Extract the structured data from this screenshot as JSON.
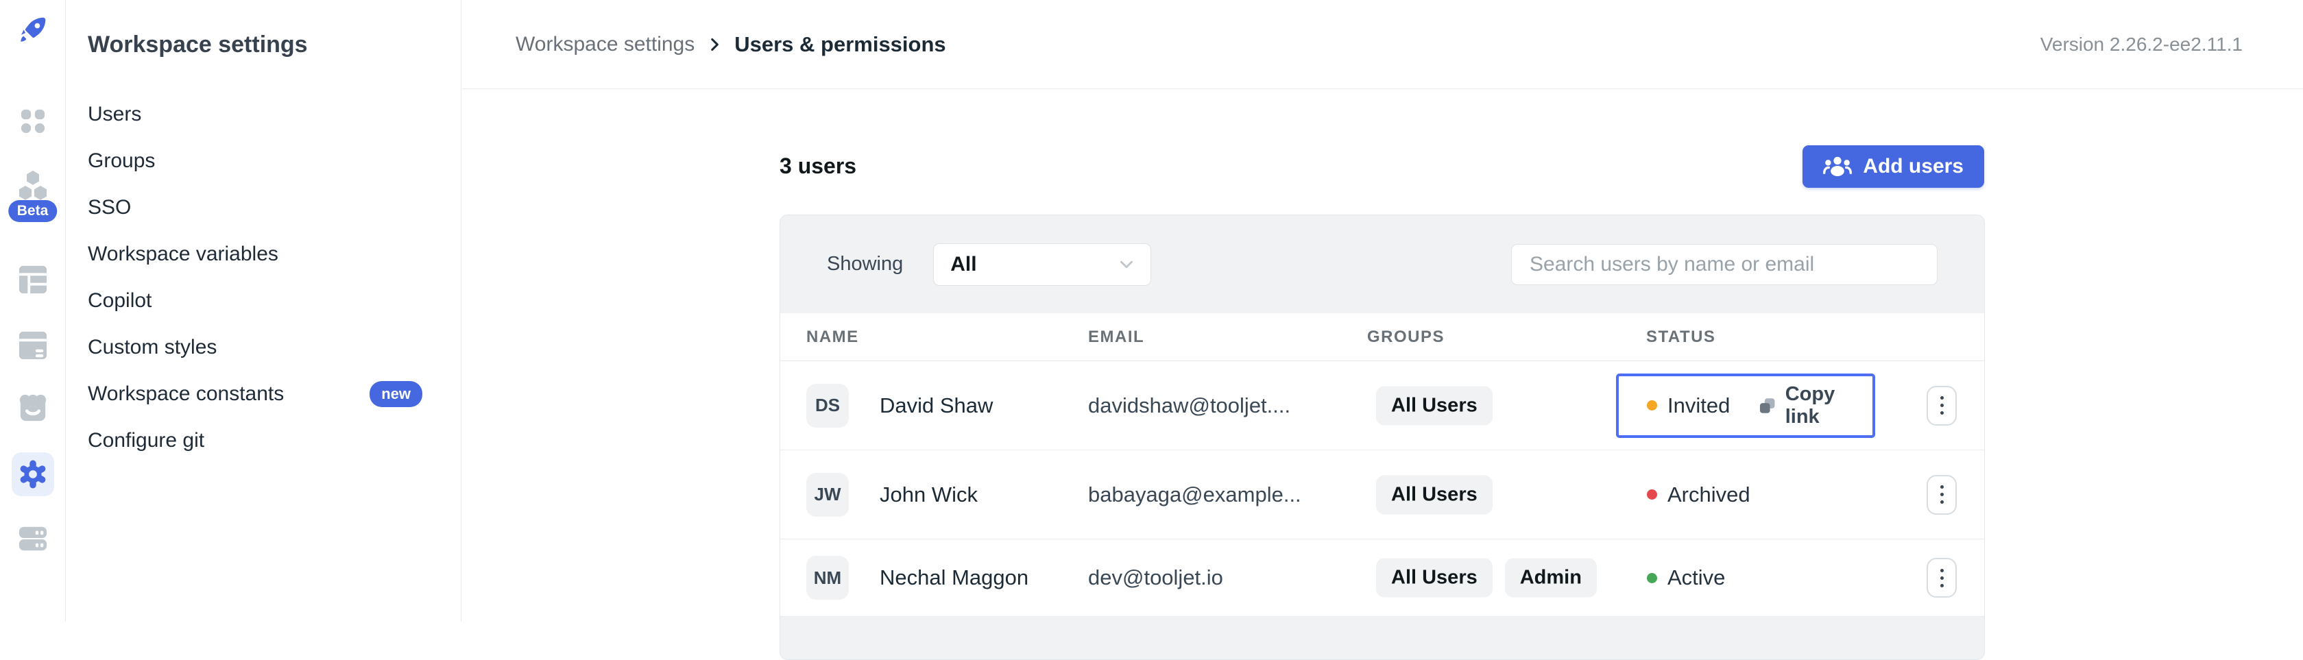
{
  "colors": {
    "primary": "#4567df",
    "highlight_border": "#4d6ef5",
    "status_invited": "#f5a623",
    "status_archived": "#e5484d",
    "status_active": "#46a758"
  },
  "rail": {
    "logo_icon": "rocket-icon",
    "beta_badge": "Beta",
    "icons": [
      "apps-grid-icon",
      "marketplace-hexagons-icon",
      "database-table-icon",
      "datasources-icon",
      "marketplace-shop-icon",
      "settings-gear-icon",
      "audit-logs-icon"
    ]
  },
  "sidebar": {
    "title": "Workspace settings",
    "items": [
      {
        "label": "Users"
      },
      {
        "label": "Groups"
      },
      {
        "label": "SSO"
      },
      {
        "label": "Workspace variables"
      },
      {
        "label": "Copilot"
      },
      {
        "label": "Custom styles"
      },
      {
        "label": "Workspace constants",
        "badge": "new"
      },
      {
        "label": "Configure git"
      }
    ]
  },
  "header": {
    "breadcrumb": {
      "parent": "Workspace settings",
      "current": "Users & permissions"
    },
    "version": "Version 2.26.2-ee2.11.1"
  },
  "main": {
    "count_label": "3 users",
    "add_users_button": "Add users",
    "filter": {
      "showing_label": "Showing",
      "selected_option": "All",
      "search_placeholder": "Search users by name or email"
    },
    "table": {
      "headers": {
        "name": "NAME",
        "email": "EMAIL",
        "groups": "GROUPS",
        "status": "STATUS"
      },
      "rows": [
        {
          "initials": "DS",
          "name": "David Shaw",
          "email": "davidshaw@tooljet....",
          "groups": [
            "All Users"
          ],
          "status": "Invited",
          "status_color": "#f5a623",
          "copy_link": "Copy link"
        },
        {
          "initials": "JW",
          "name": "John Wick",
          "email": "babayaga@example...",
          "groups": [
            "All Users"
          ],
          "status": "Archived",
          "status_color": "#e5484d"
        },
        {
          "initials": "NM",
          "name": "Nechal Maggon",
          "email": "dev@tooljet.io",
          "groups": [
            "All Users",
            "Admin"
          ],
          "status": "Active",
          "status_color": "#46a758"
        }
      ]
    }
  }
}
